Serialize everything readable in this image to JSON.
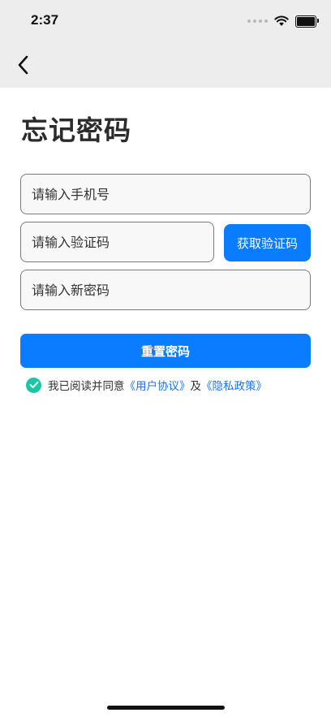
{
  "status_bar": {
    "time": "2:37",
    "icons": [
      "cellular-dots-icon",
      "wifi-icon",
      "battery-icon"
    ]
  },
  "nav": {
    "back_icon": "chevron-left-icon"
  },
  "page": {
    "title": "忘记密码"
  },
  "form": {
    "phone_placeholder": "请输入手机号",
    "code_placeholder": "请输入验证码",
    "get_code_label": "获取验证码",
    "new_password_placeholder": "请输入新密码",
    "reset_label": "重置密码"
  },
  "agreement": {
    "checked": true,
    "prefix": "我已阅读并同意",
    "user_agreement": "《用户协议》",
    "conjunction": "及",
    "privacy_policy": "《隐私政策》"
  },
  "colors": {
    "primary": "#0a7cff",
    "check": "#19c6a5",
    "link": "#1a73e8",
    "header_bg": "#ededed"
  }
}
